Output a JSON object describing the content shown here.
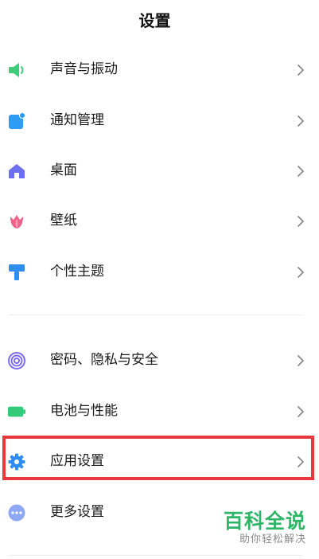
{
  "header": {
    "title": "设置"
  },
  "group1": [
    {
      "label": "声音与振动",
      "icon": "speaker-icon",
      "color": "#3ccf7a"
    },
    {
      "label": "通知管理",
      "icon": "notification-icon",
      "color": "#2e9bf5"
    },
    {
      "label": "桌面",
      "icon": "home-icon",
      "color": "#6e6ef2"
    },
    {
      "label": "壁纸",
      "icon": "tulip-icon",
      "color": "#f0628a"
    },
    {
      "label": "个性主题",
      "icon": "paint-roller-icon",
      "color": "#2f8ef0"
    }
  ],
  "group2": [
    {
      "label": "密码、隐私与安全",
      "icon": "fingerprint-icon",
      "color": "#7a6cf0"
    },
    {
      "label": "电池与性能",
      "icon": "battery-icon",
      "color": "#35c97a"
    },
    {
      "label": "应用设置",
      "icon": "gear-icon",
      "color": "#2e8df2"
    },
    {
      "label": "更多设置",
      "icon": "more-dots-icon",
      "color": "#8fa8f5"
    }
  ],
  "highlight_color": "#e8383d",
  "watermark": {
    "main": "百科全说",
    "sub": "助你轻松解决",
    "color": "#2fb567"
  }
}
